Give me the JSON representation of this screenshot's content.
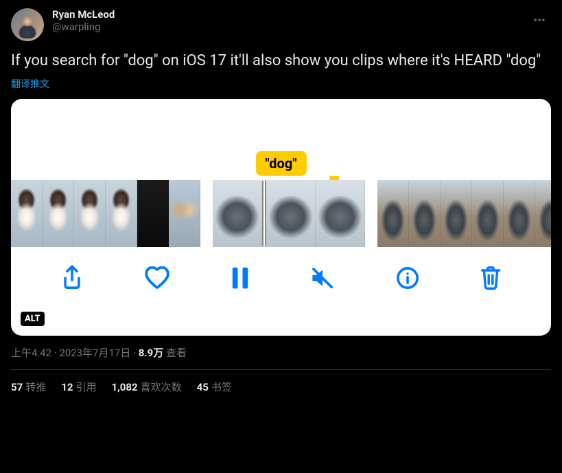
{
  "author": {
    "display_name": "Ryan McLeod",
    "handle": "@warpling"
  },
  "tweet_text": "If you search for \"dog\" on iOS 17 it'll also show you clips where it's HEARD \"dog\"",
  "translate_label": "翻译推文",
  "media": {
    "caption": "\"dog\"",
    "alt_badge": "ALT",
    "toolbar": {
      "share": "share-icon",
      "like": "heart-icon",
      "pause": "pause-icon",
      "mute": "mute-icon",
      "info": "info-icon",
      "trash": "trash-icon"
    }
  },
  "meta": {
    "time": "上午4:42",
    "date": "2023年7月17日",
    "views_count": "8.9万",
    "views_label": "查看",
    "separator": " · "
  },
  "stats": {
    "retweets": {
      "count": "57",
      "label": "转推"
    },
    "quotes": {
      "count": "12",
      "label": "引用"
    },
    "likes": {
      "count": "1,082",
      "label": "喜欢次数"
    },
    "bookmarks": {
      "count": "45",
      "label": "书签"
    }
  }
}
